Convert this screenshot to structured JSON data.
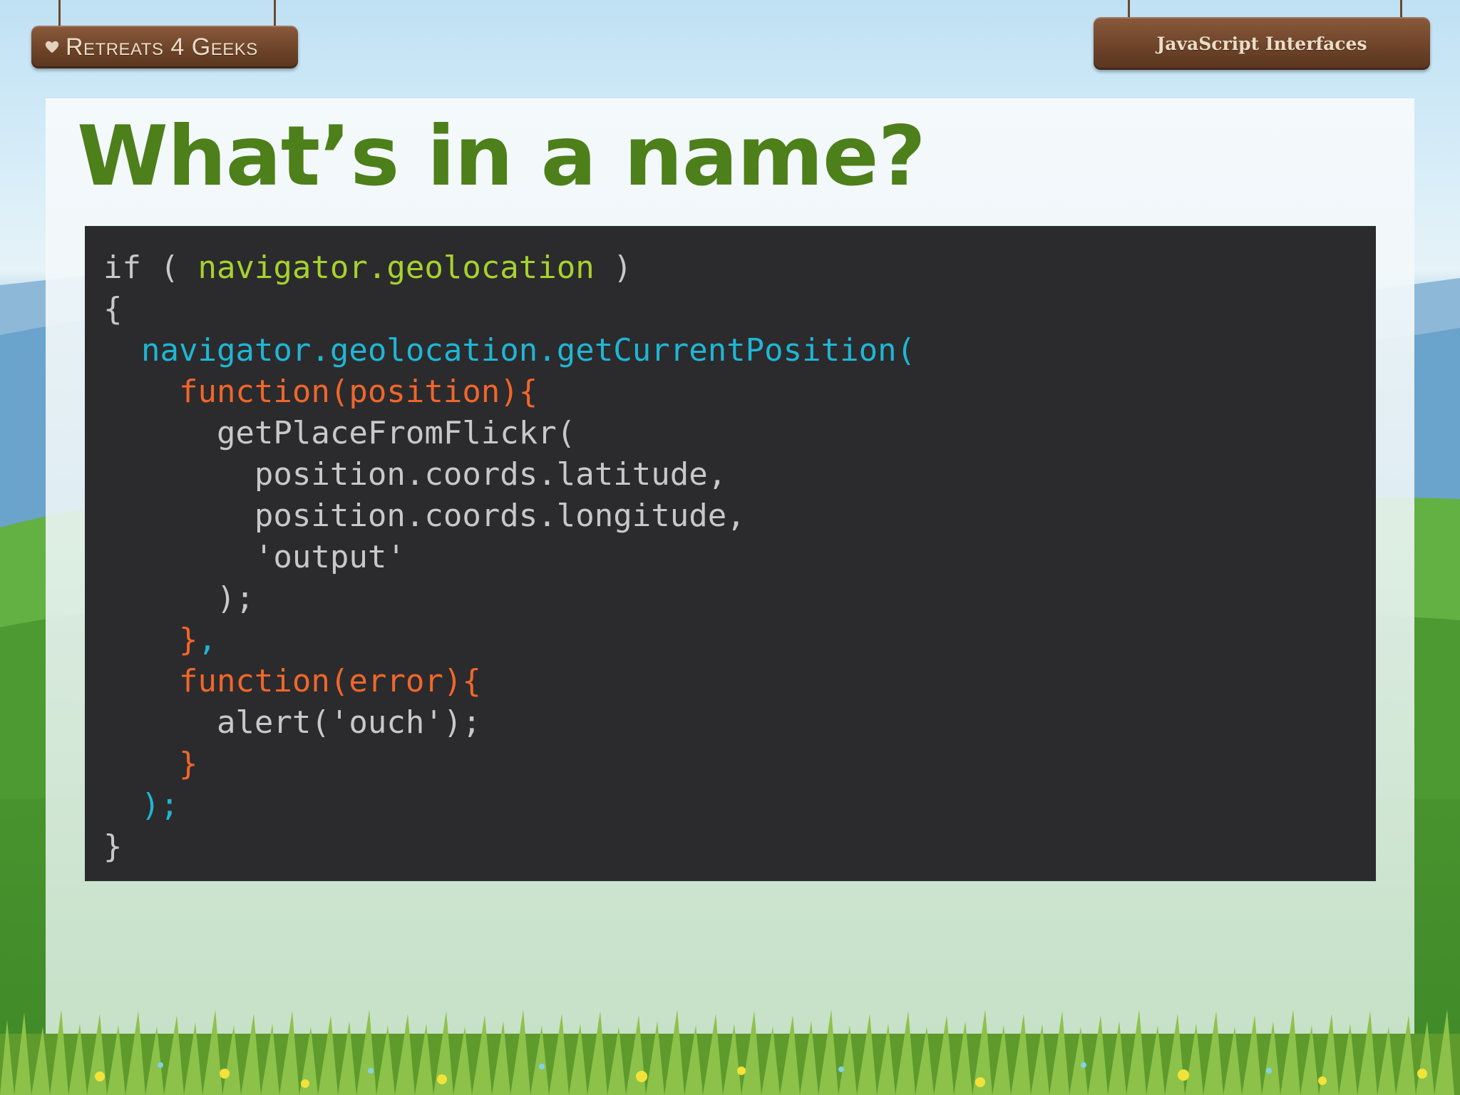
{
  "header": {
    "logo_text": "Retreats 4 Geeks",
    "deck_title": "JavaScript Interfaces"
  },
  "slide": {
    "title": "What’s in a name?"
  },
  "code_lines": [
    [
      {
        "t": "if ( ",
        "c": "default"
      },
      {
        "t": "navigator.geolocation",
        "c": "green"
      },
      {
        "t": " )",
        "c": "default"
      }
    ],
    [
      {
        "t": "{",
        "c": "default"
      }
    ],
    [
      {
        "t": "  navigator.geolocation.getCurrentPosition(",
        "c": "cyan"
      }
    ],
    [
      {
        "t": "    function(position){",
        "c": "orange"
      }
    ],
    [
      {
        "t": "      getPlaceFromFlickr(",
        "c": "default"
      }
    ],
    [
      {
        "t": "        position.coords.latitude,",
        "c": "default"
      }
    ],
    [
      {
        "t": "        position.coords.longitude,",
        "c": "default"
      }
    ],
    [
      {
        "t": "        'output'",
        "c": "default"
      }
    ],
    [
      {
        "t": "      );",
        "c": "default"
      }
    ],
    [
      {
        "t": "    }",
        "c": "orange"
      },
      {
        "t": ",",
        "c": "cyan"
      }
    ],
    [
      {
        "t": "    function(error){",
        "c": "orange"
      }
    ],
    [
      {
        "t": "      alert('ouch');",
        "c": "default"
      }
    ],
    [
      {
        "t": "    }",
        "c": "orange"
      }
    ],
    [
      {
        "t": "  );",
        "c": "cyan"
      }
    ],
    [
      {
        "t": "}",
        "c": "default"
      }
    ]
  ],
  "colors": {
    "title": "#4d7f1a",
    "code_background": "#2b2b2d",
    "code_default": "#c8c8c8",
    "code_green": "#a6d22e",
    "code_cyan": "#1fb6d4",
    "code_orange": "#f0662b"
  },
  "icons": {
    "logo": "heart-icon"
  }
}
